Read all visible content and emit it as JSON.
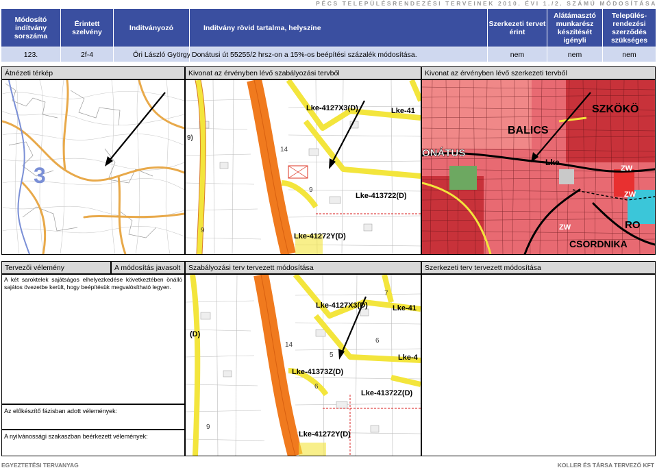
{
  "document": {
    "header_text": "PÉCS TELEPÜLÉSRENDEZÉSI TERVEINEK 2010. ÉVI 1./2. SZÁMÚ MÓDOSÍTÁSA",
    "footer_left": "EGYEZTETÉSI TERVANYAG",
    "footer_right": "KOLLER ÉS TÁRSA TERVEZŐ KFT"
  },
  "table": {
    "headers": {
      "modosito": "Módosító indítvány sorszáma",
      "szelveny": "Érintett szelvény",
      "inditvanyozo": "Indítványozó",
      "tartalom": "Indítvány rövid tartalma, helyszíne",
      "szerkezeti": "Szerkezeti tervet érint",
      "alatamaszto": "Alátámasztó munkarész készítését igényli",
      "telepules": "Település-rendezési szerződés szükséges"
    },
    "row": {
      "sorszam": "123.",
      "szelveny": "2f-4",
      "inditvanyozo": "Őri László György",
      "tartalom": "Donátusi út 55255/2 hrsz-on a 15%-os beépítési százalék módosítása.",
      "szerkezeti": "nem",
      "alatamaszto": "nem",
      "telepules": "nem"
    }
  },
  "section1": {
    "label1": "Átnézeti térkép",
    "label2": "Kivonat az érvényben lévő szabályozási tervből",
    "label3": "Kivonat az érvényben lévő szerkezeti tervből"
  },
  "section2": {
    "label_velemeny": "Tervezői vélemény",
    "label_javasolt": "A módosítás javasolt",
    "label_szab": "Szabályozási terv tervezett módosítása",
    "label_szerk": "Szerkezeti terv tervezett módosítása",
    "velemeny_text": "A két saroktelek sajátságos elhelyezkedése következtében önálló sajátos övezetbe került, hogy beépítésük megvalósítható legyen.",
    "elokeszito": "Az előkészítő fázisban adott vélemények:",
    "nyilvanossagi": "A nyilvánossági szakaszban beérkezett vélemények:"
  },
  "maps": {
    "overview_number": "3",
    "reg_labels": [
      "Lke-4127X3(D)",
      "Lke-41",
      "Lke-413722(D)",
      "Lke-41272Y(D)",
      "14",
      "9",
      "9",
      "9)"
    ],
    "struct_labels": [
      "SZKÖKÖ",
      "BALICS",
      "ONÁTUS",
      "Lke",
      "RO",
      "CSORDNIKA",
      "ZW",
      "ZW",
      "ZW"
    ],
    "plan_labels": [
      "Lke-4127X3(D)",
      "Lke-41",
      "Lke-4",
      "Lke-41373Z(D)",
      "Lke-41372Z(D)",
      "Lke-41272Y(D)",
      "(D)",
      "14",
      "6",
      "6",
      "5",
      "9",
      "7"
    ]
  },
  "colors": {
    "header_navy": "#3a4fa0",
    "row_blue": "#cfd8ef",
    "label_gray": "#d9d9d9",
    "road_orange": "#f07a1e",
    "road_yellow": "#f3e53c",
    "struct_red": "#c8323a",
    "struct_pink": "#f08888"
  }
}
